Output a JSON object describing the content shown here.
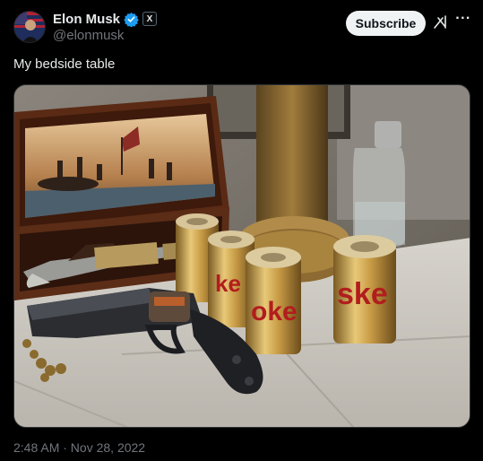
{
  "author": {
    "name": "Elon Musk",
    "handle": "@elonmusk",
    "badge": "X"
  },
  "subscribe_label": "Subscribe",
  "tweet": {
    "text": "My bedside table",
    "timestamp": "2:48 AM · Nov 28, 2022"
  },
  "icons": {
    "verified": "verified-badge-icon",
    "grok": "grok-icon",
    "more": "more-icon"
  },
  "more_glyph": "···",
  "colors": {
    "background": "#000000",
    "text": "#e7e9ea",
    "secondary": "#71767b",
    "verified": "#1d9bf0",
    "button_bg": "#eff3f4"
  }
}
